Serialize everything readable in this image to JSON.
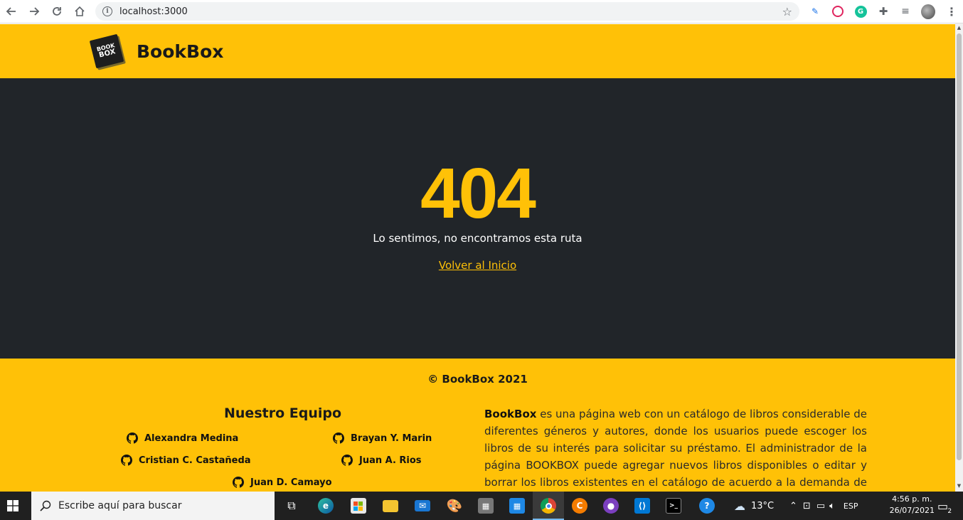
{
  "browser": {
    "url": "localhost:3000",
    "back_icon": "back-arrow-icon",
    "forward_icon": "forward-arrow-icon",
    "reload_icon": "reload-icon",
    "home_icon": "home-icon"
  },
  "header": {
    "logo_line1": "BOOK",
    "logo_line2": "BOX",
    "brand": "BookBox"
  },
  "main": {
    "code": "404",
    "message": "Lo sentimos, no encontramos esta ruta",
    "back_link": "Volver al Inicio"
  },
  "footer": {
    "copyright": "© BookBox 2021",
    "team_title": "Nuestro Equipo",
    "members": [
      "Alexandra Medina",
      "Brayan Y. Marin",
      "Cristian C. Castañeda",
      "Juan A. Rios",
      "Juan D. Camayo"
    ],
    "about_brand": "BookBox",
    "about_text": " es una página web con un catálogo de libros considerable de diferentes géneros y autores, donde los usuarios puede escoger los libros de su interés para solicitar su préstamo. El administrador de la página BOOKBOX puede agregar nuevos libros disponibles o editar y borrar los libros existentes en el catálogo de acuerdo a la demanda de los mismo."
  },
  "taskbar": {
    "search_placeholder": "Escribe aquí para buscar",
    "weather": "13°C",
    "language": "ESP",
    "time": "4:56 p. m.",
    "date": "26/07/2021",
    "notifications": "2"
  },
  "colors": {
    "accent": "#ffc107",
    "dark": "#212529"
  }
}
